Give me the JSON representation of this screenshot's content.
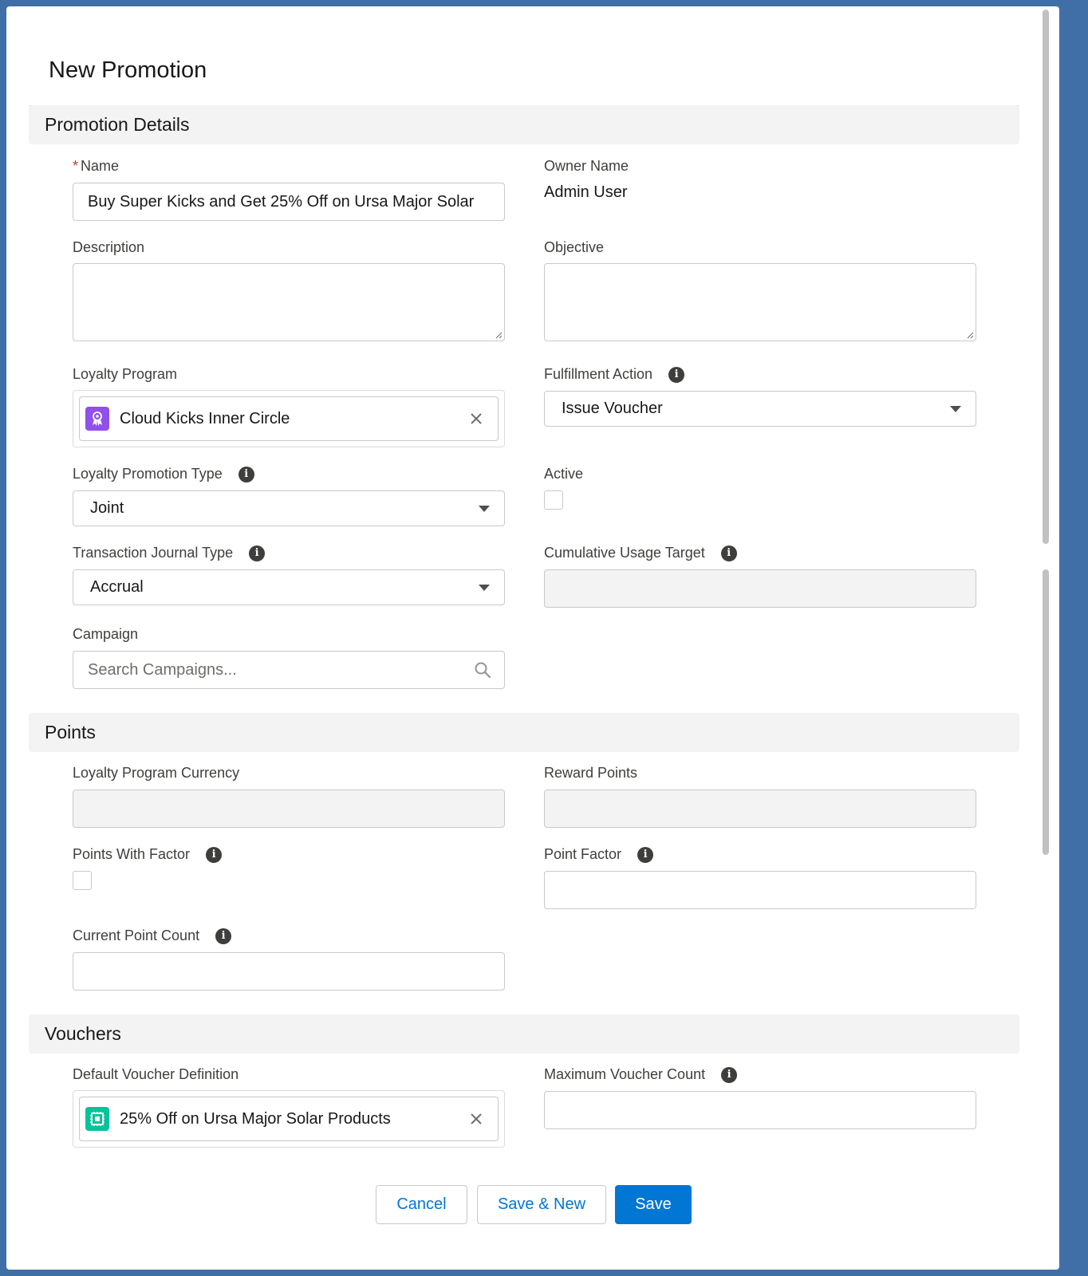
{
  "modal": {
    "title": "New Promotion"
  },
  "sections": {
    "details": "Promotion Details",
    "points": "Points",
    "vouchers": "Vouchers"
  },
  "fields": {
    "name": {
      "label": "Name",
      "required_marker": "*",
      "value": "Buy Super Kicks and Get 25% Off on Ursa Major Solar"
    },
    "owner_name": {
      "label": "Owner Name",
      "value": "Admin User"
    },
    "description": {
      "label": "Description",
      "value": ""
    },
    "objective": {
      "label": "Objective",
      "value": ""
    },
    "loyalty_program": {
      "label": "Loyalty Program",
      "value": "Cloud Kicks Inner Circle",
      "icon": "loyalty-program-icon",
      "icon_color": "#9050e9"
    },
    "fulfillment_action": {
      "label": "Fulfillment Action",
      "value": "Issue Voucher"
    },
    "loyalty_promotion_type": {
      "label": "Loyalty Promotion Type",
      "value": "Joint"
    },
    "active": {
      "label": "Active",
      "checked": false
    },
    "transaction_journal_type": {
      "label": "Transaction Journal Type",
      "value": "Accrual"
    },
    "cumulative_usage_target": {
      "label": "Cumulative Usage Target",
      "value": ""
    },
    "campaign": {
      "label": "Campaign",
      "placeholder": "Search Campaigns..."
    },
    "loyalty_program_currency": {
      "label": "Loyalty Program Currency",
      "value": ""
    },
    "reward_points": {
      "label": "Reward Points",
      "value": ""
    },
    "points_with_factor": {
      "label": "Points With Factor",
      "checked": false
    },
    "point_factor": {
      "label": "Point Factor",
      "value": ""
    },
    "current_point_count": {
      "label": "Current Point Count",
      "value": ""
    },
    "default_voucher_definition": {
      "label": "Default Voucher Definition",
      "value": "25% Off on Ursa Major Solar Products",
      "icon": "voucher-icon",
      "icon_color": "#04c39a"
    },
    "maximum_voucher_count": {
      "label": "Maximum Voucher Count",
      "value": ""
    }
  },
  "info_glyph": "i",
  "footer": {
    "cancel": "Cancel",
    "save_new": "Save & New",
    "save": "Save"
  },
  "colors": {
    "brand": "#0176d3",
    "required": "#c23934",
    "section_bg": "#f3f3f3"
  }
}
